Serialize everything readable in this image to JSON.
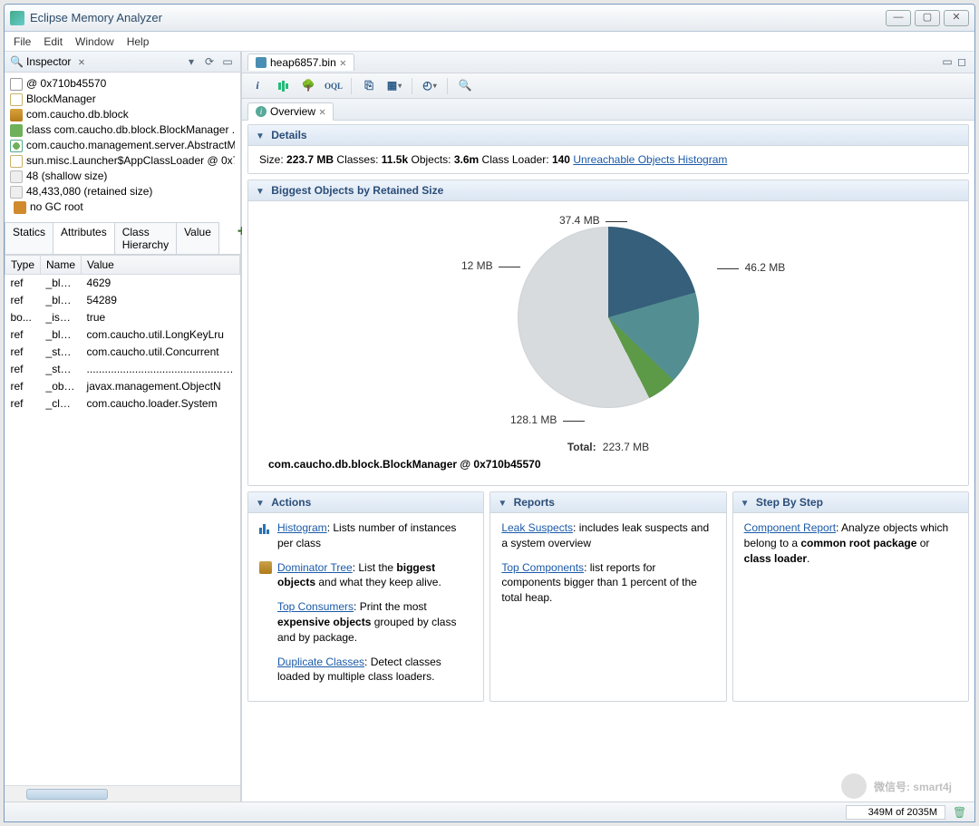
{
  "window": {
    "title": "Eclipse Memory Analyzer"
  },
  "menubar": [
    "File",
    "Edit",
    "Window",
    "Help"
  ],
  "inspector": {
    "title": "Inspector",
    "tree": [
      {
        "icon": "ic-at",
        "label": "@ 0x710b45570"
      },
      {
        "icon": "ic-doc",
        "label": "BlockManager"
      },
      {
        "icon": "ic-pkg",
        "label": "com.caucho.db.block"
      },
      {
        "icon": "ic-cls",
        "label": "class com.caucho.db.block.BlockManager ..."
      },
      {
        "icon": "ic-q",
        "label": "com.caucho.management.server.AbstractM..."
      },
      {
        "icon": "ic-doc",
        "label": "sun.misc.Launcher$AppClassLoader @ 0x71..."
      },
      {
        "icon": "ic-sz",
        "label": "48 (shallow size)"
      },
      {
        "icon": "ic-sz",
        "label": "48,433,080 (retained size)"
      },
      {
        "icon": "ic-dot",
        "label": "no GC root"
      }
    ],
    "tabs": [
      "Statics",
      "Attributes",
      "Class Hierarchy",
      "Value"
    ],
    "active_tab": "Attributes",
    "columns": [
      "Type",
      "Name",
      "Value"
    ],
    "rows": [
      {
        "type": "ref",
        "name": "_blockRe...",
        "value": "4629"
      },
      {
        "type": "ref",
        "name": "_blockWri...",
        "value": "54289"
      },
      {
        "type": "bo...",
        "name": "_isEnable...",
        "value": "true"
      },
      {
        "type": "ref",
        "name": "_blockCa...",
        "value": "com.caucho.util.LongKeyLru"
      },
      {
        "type": "ref",
        "name": "_storeList",
        "value": "com.caucho.util.Concurrent"
      },
      {
        "type": "ref",
        "name": "_storeMa...",
        "value": "................................................."
      },
      {
        "type": "ref",
        "name": "_objectN...",
        "value": "javax.management.ObjectN"
      },
      {
        "type": "ref",
        "name": "_classLoa...",
        "value": "com.caucho.loader.System"
      }
    ]
  },
  "editor": {
    "file_tab": "heap6857.bin",
    "overview_tab": "Overview",
    "details": {
      "title": "Details",
      "size_label": "Size:",
      "size": "223.7 MB",
      "classes_label": "Classes:",
      "classes": "11.5k",
      "objects_label": "Objects:",
      "objects": "3.6m",
      "classloader_label": "Class Loader:",
      "classloader": "140",
      "link": "Unreachable Objects Histogram"
    },
    "biggest_title": "Biggest Objects by Retained Size",
    "chart_caption": "com.caucho.db.block.BlockManager @ 0x710b45570",
    "chart_total_label": "Total:",
    "chart_total_value": "223.7 MB",
    "actions": {
      "title": "Actions",
      "items": [
        {
          "link": "Histogram",
          "rest": ": Lists number of instances per class"
        },
        {
          "link": "Dominator Tree",
          "bold": "biggest objects",
          "before": ": List the ",
          "after": " and what they keep alive."
        },
        {
          "link": "Top Consumers",
          "bold": "expensive objects",
          "before": ": Print the most ",
          "after": " grouped by class and by package."
        },
        {
          "link": "Duplicate Classes",
          "rest": ": Detect classes loaded by multiple class loaders."
        }
      ]
    },
    "reports": {
      "title": "Reports",
      "items": [
        {
          "link": "Leak Suspects",
          "rest": ": includes leak suspects and a system overview"
        },
        {
          "link": "Top Components",
          "rest": ": list reports for components bigger than 1 percent of the total heap."
        }
      ]
    },
    "step": {
      "title": "Step By Step",
      "link": "Component Report",
      "before": ": Analyze objects which belong to a ",
      "bold1": "common root package",
      "mid": " or ",
      "bold2": "class loader",
      "after": "."
    }
  },
  "status": {
    "memory": "349M of 2035M"
  },
  "watermark": "微信号: smart4j",
  "chart_data": {
    "type": "pie",
    "title": "Biggest Objects by Retained Size",
    "unit": "MB",
    "total": 223.7,
    "slices": [
      {
        "label": "46.2 MB",
        "value": 46.2,
        "color": "#355f7a"
      },
      {
        "label": "37.4 MB",
        "value": 37.4,
        "color": "#538f92"
      },
      {
        "label": "12 MB",
        "value": 12.0,
        "color": "#5d9a48"
      },
      {
        "label": "128.1 MB",
        "value": 128.1,
        "color": "#d7dbdd"
      }
    ]
  }
}
